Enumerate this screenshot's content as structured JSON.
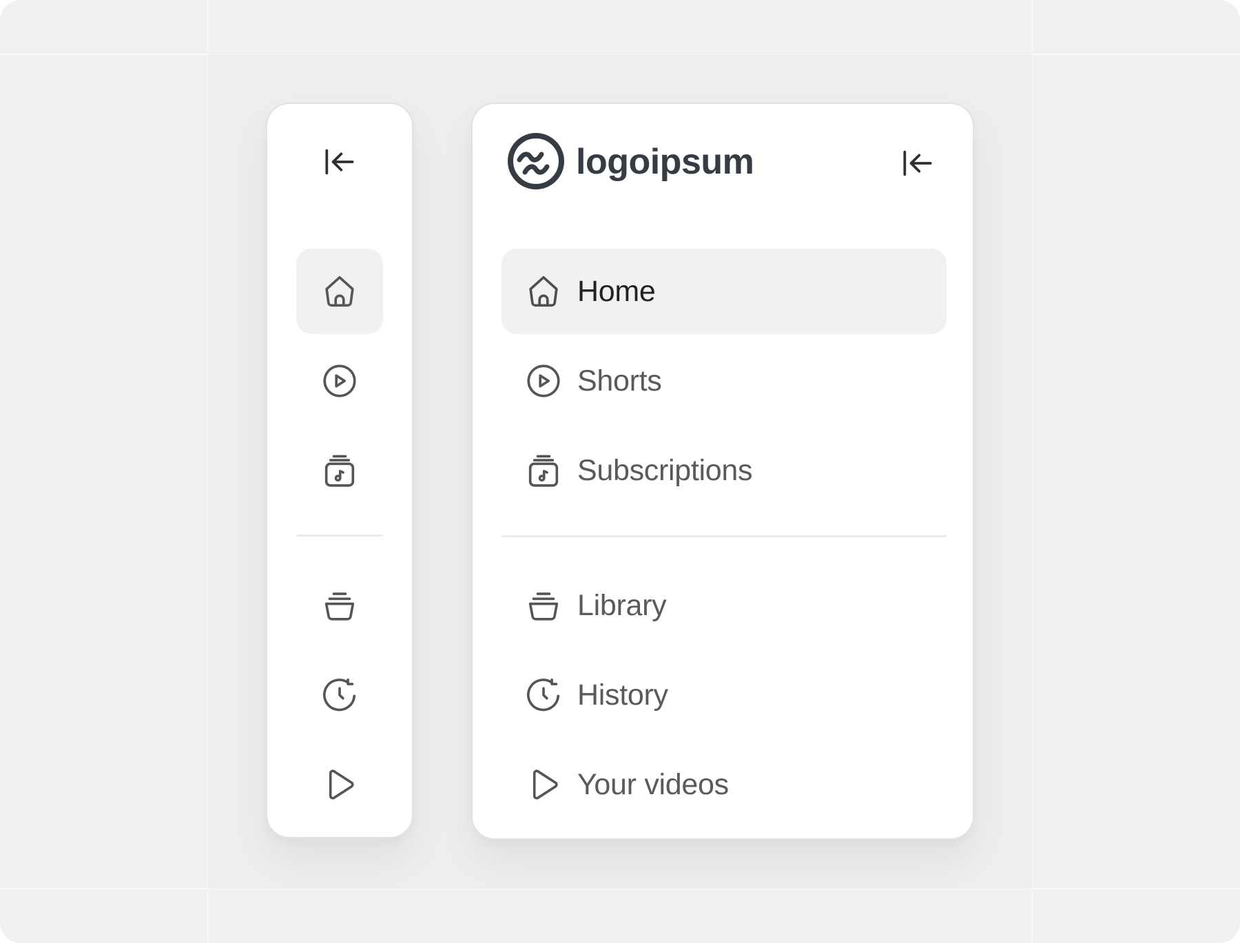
{
  "brand": {
    "name": "logoipsum"
  },
  "collapse": {
    "icon": "collapse-left-icon"
  },
  "nav": {
    "primary": [
      {
        "label": "Home",
        "icon": "home-icon",
        "active": true
      },
      {
        "label": "Shorts",
        "icon": "play-circle-icon",
        "active": false
      },
      {
        "label": "Subscriptions",
        "icon": "subscriptions-icon",
        "active": false
      }
    ],
    "secondary": [
      {
        "label": "Library",
        "icon": "library-icon",
        "active": false
      },
      {
        "label": "History",
        "icon": "history-icon",
        "active": false
      },
      {
        "label": "Your videos",
        "icon": "play-icon",
        "active": false
      }
    ]
  },
  "colors": {
    "background": "#f1f1f1",
    "panel": "#ffffff",
    "active_item": "#f1f1f1",
    "text": "#5a5a5a",
    "active_text": "#222222",
    "logo": "#353c44"
  }
}
